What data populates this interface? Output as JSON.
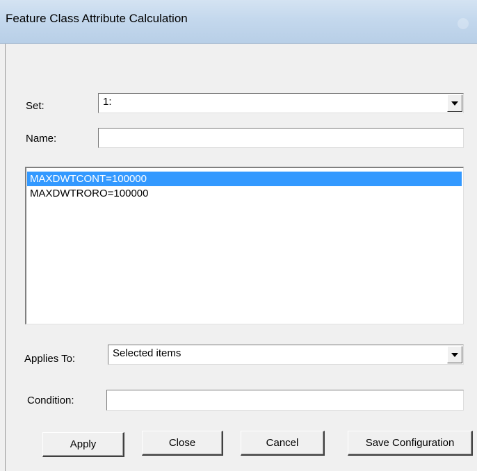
{
  "window": {
    "title": "Feature Class Attribute Calculation"
  },
  "form": {
    "set_label": "Set:",
    "set_value": "1:",
    "name_label": "Name:",
    "name_value": "",
    "applies_to_label": "Applies To:",
    "applies_to_value": "Selected items",
    "condition_label": "Condition:",
    "condition_value": ""
  },
  "list": {
    "items": [
      {
        "text": "MAXDWTCONT=100000",
        "selected": true
      },
      {
        "text": "MAXDWTRORO=100000",
        "selected": false
      }
    ]
  },
  "buttons": {
    "apply": "Apply",
    "close": "Close",
    "cancel": "Cancel",
    "save_configuration": "Save Configuration"
  },
  "colors": {
    "selection": "#3399ff",
    "titlebar": "#c4d8ed",
    "background": "#f0f0f0"
  }
}
